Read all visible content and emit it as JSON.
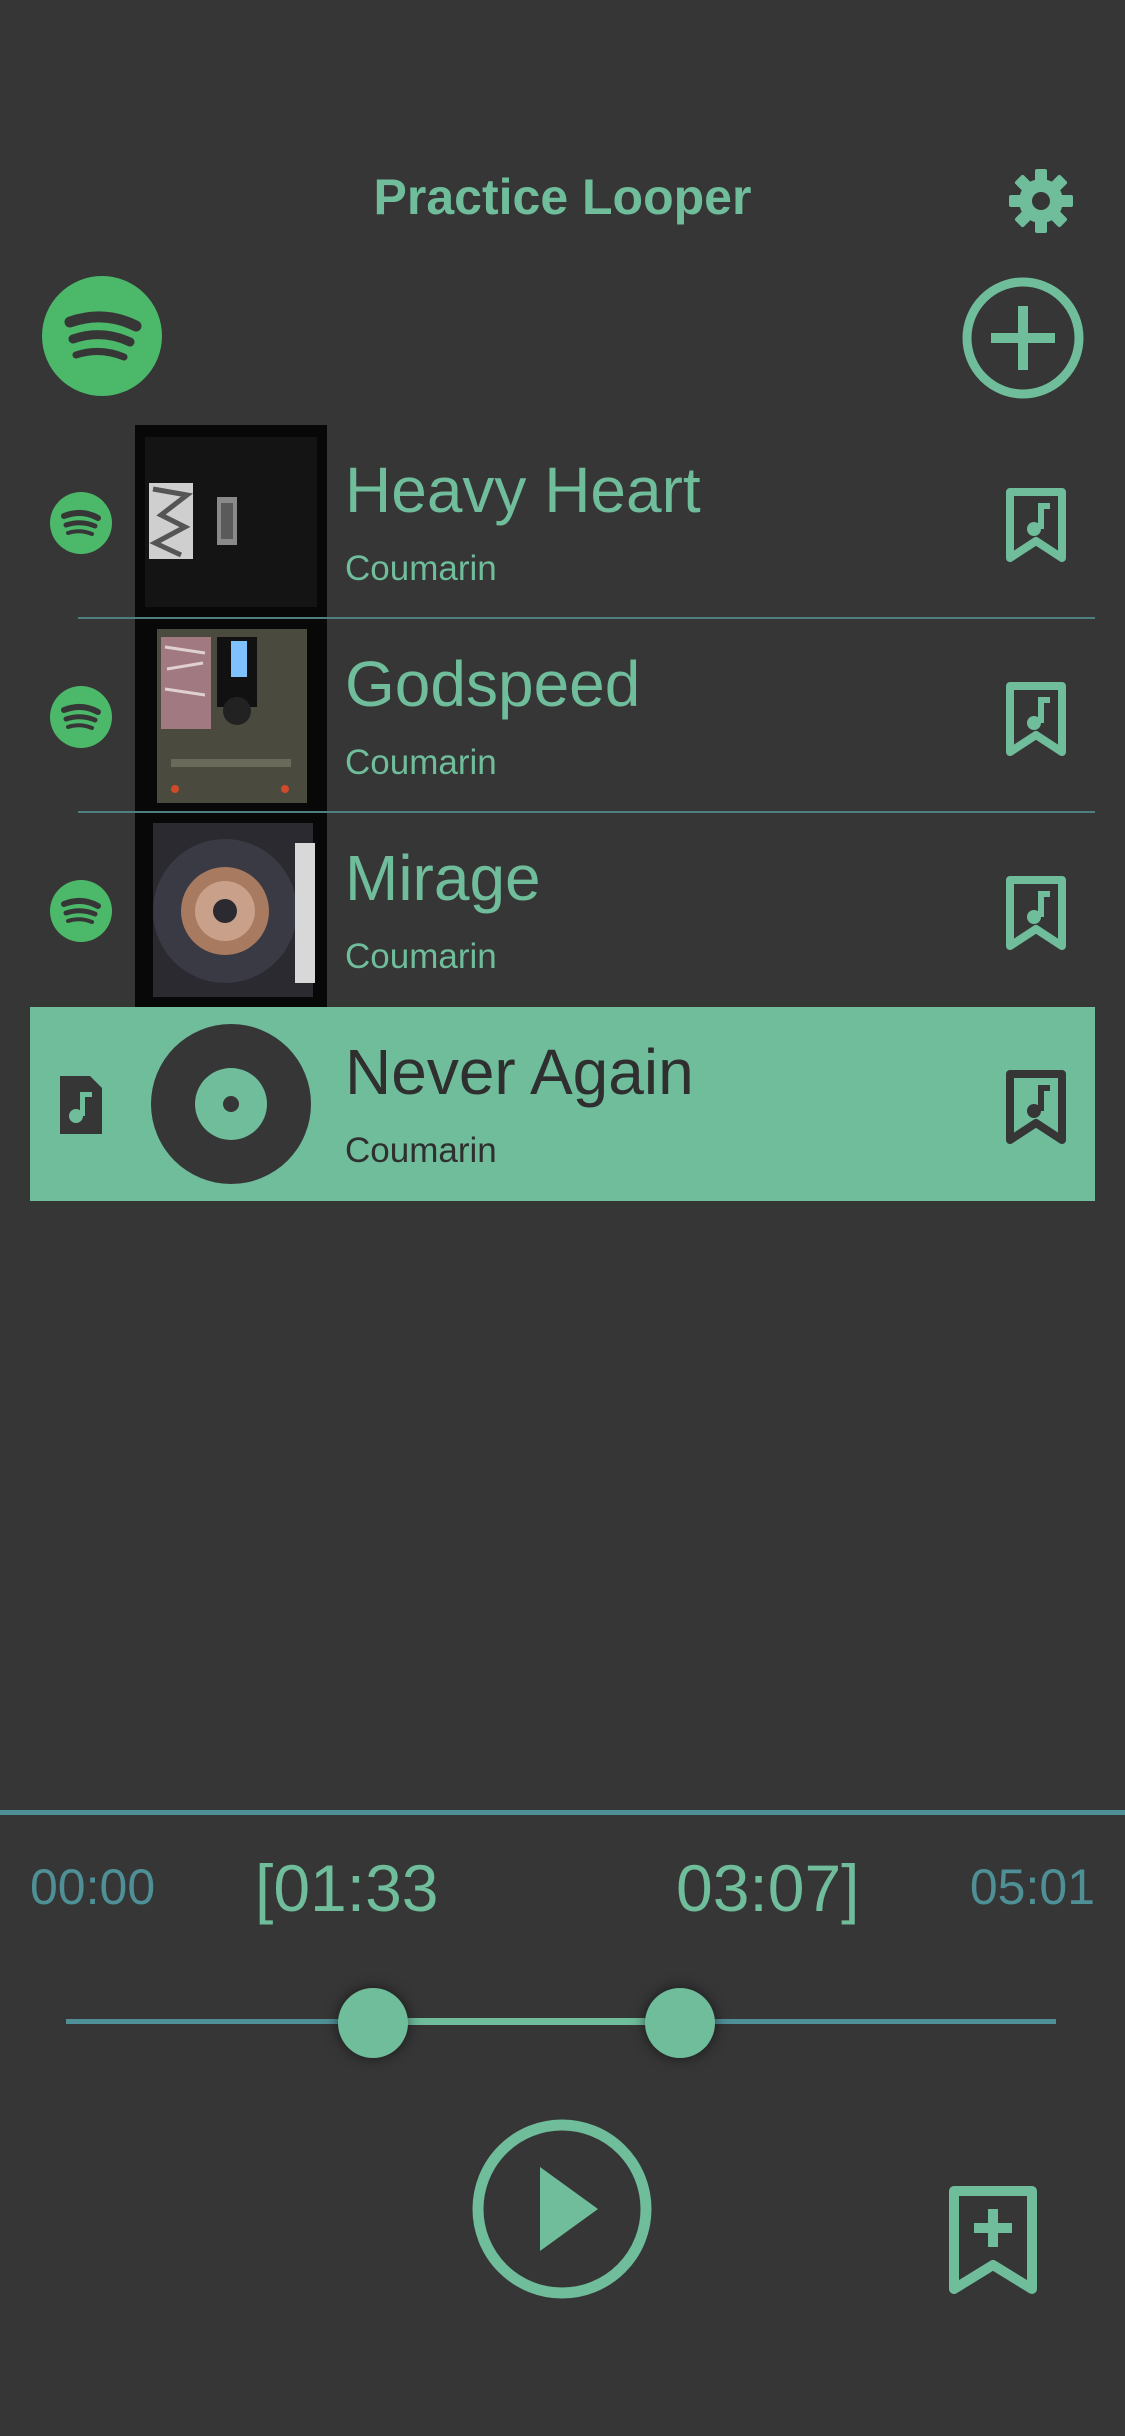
{
  "header": {
    "title": "Practice Looper"
  },
  "songs": [
    {
      "title": "Heavy Heart",
      "artist": "Coumarin",
      "source": "spotify-icon",
      "selected": false
    },
    {
      "title": "Godspeed",
      "artist": "Coumarin",
      "source": "spotify-icon",
      "selected": false
    },
    {
      "title": "Mirage",
      "artist": "Coumarin",
      "source": "spotify-icon",
      "selected": false
    },
    {
      "title": "Never Again",
      "artist": "Coumarin",
      "source": "music-file-icon",
      "selected": true
    }
  ],
  "player": {
    "position": "00:00",
    "loop_start": "[01:33",
    "loop_end": "03:07]",
    "duration": "05:01",
    "loop_start_fraction": 0.31,
    "loop_end_fraction": 0.62
  },
  "colors": {
    "background": "#363636",
    "accent": "#6fbd9b",
    "spotify": "#4cb86a",
    "muted_teal": "#4f8f96"
  }
}
